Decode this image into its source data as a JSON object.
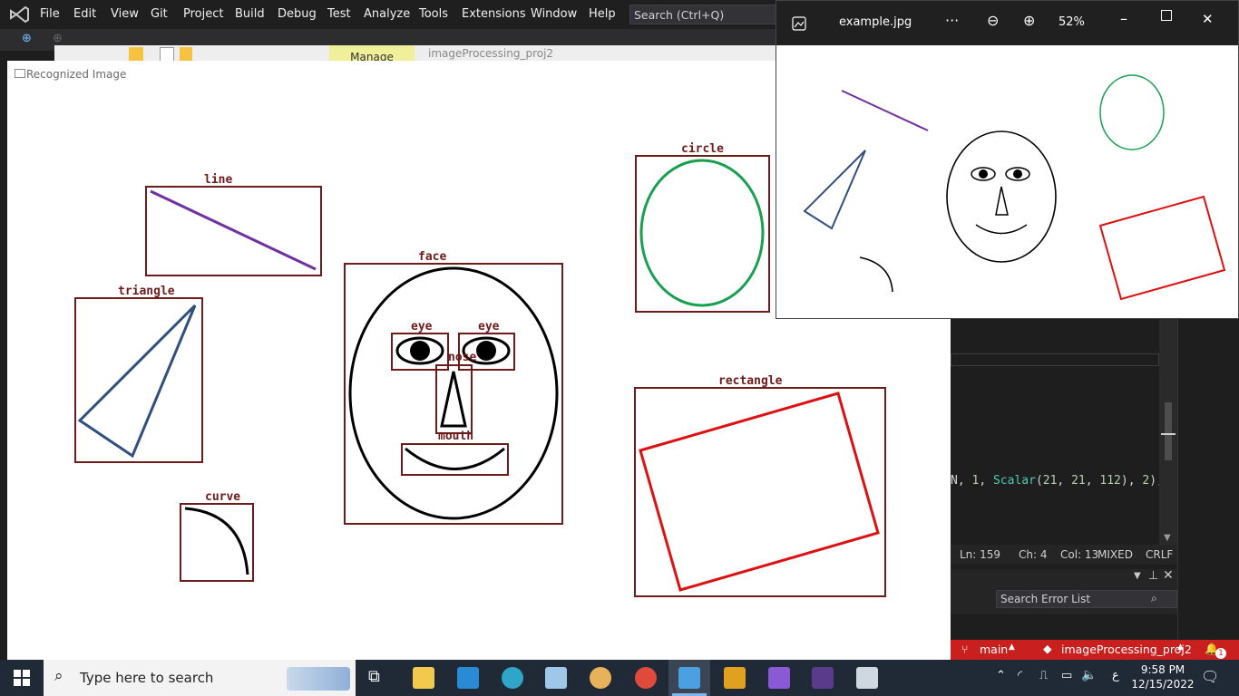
{
  "vs": {
    "menu": [
      "File",
      "Edit",
      "View",
      "Git",
      "Project",
      "Build",
      "Debug",
      "Test",
      "Analyze",
      "Tools",
      "Extensions",
      "Window",
      "Help"
    ],
    "search_label": "Search (Ctrl+Q)",
    "manage_tab": "Manage",
    "project_tab": "imageProcessing_proj2",
    "code_line": "N, 1, Scalar(21, 21, 112), 2);",
    "code_colors": {
      "keyword": "#4ec9b0",
      "number": "#b5cea8",
      "text": "#d4d4d4"
    },
    "status": {
      "ln": "Ln: 159",
      "ch": "Ch: 4",
      "col": "Col: 13",
      "mixed": "MIXED",
      "crlf": "CRLF"
    },
    "error_search": "Search Error List",
    "branch": "main",
    "repo": "imageProcessing_proj2",
    "notifications": "1",
    "statusbar_color": "#ca1f1f"
  },
  "recognized": {
    "title": "Recognized Image",
    "labels": {
      "line": "line",
      "triangle": "triangle",
      "curve": "curve",
      "face": "face",
      "eye_left": "eye",
      "eye_right": "eye",
      "nose": "nose",
      "mouth": "mouth",
      "circle": "circle",
      "rectangle": "rectangle"
    },
    "box_color": "#6e1b1b",
    "shape_colors": {
      "line": "#7030a0",
      "triangle": "#2f4f7f",
      "circle": "#18a050",
      "rectangle": "#dd1111",
      "face": "#000000"
    }
  },
  "photos": {
    "filename": "example.jpg",
    "more": "···",
    "zoom": "52%"
  },
  "taskbar": {
    "search_placeholder": "Type here to search",
    "time": "9:58 PM",
    "date": "12/15/2022",
    "lang": "ع"
  }
}
